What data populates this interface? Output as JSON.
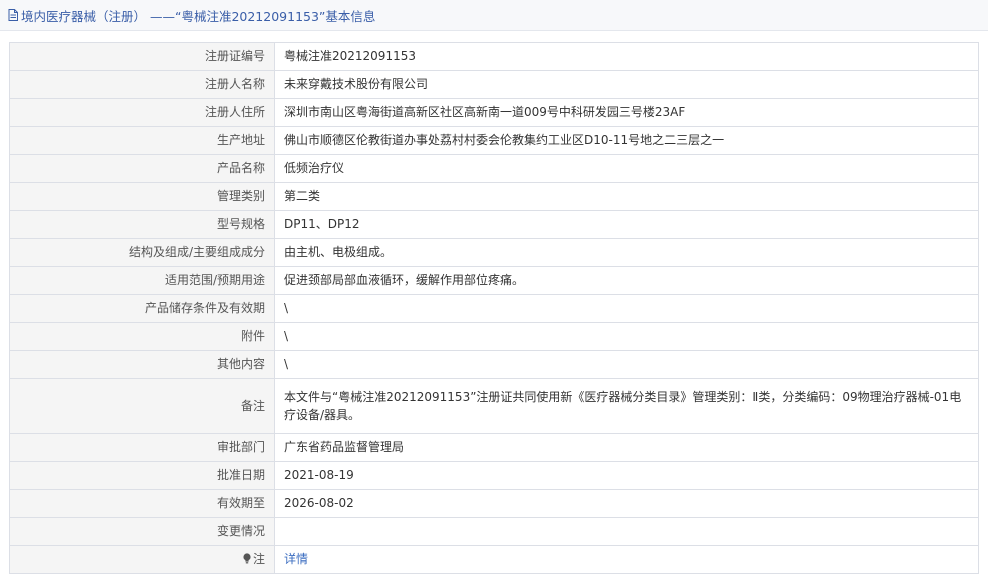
{
  "header": {
    "icon": "document-icon",
    "title": "境内医疗器械（注册） ——“粤械注准20212091153”基本信息"
  },
  "rows": [
    {
      "label": "注册证编号",
      "value": "粤械注准20212091153"
    },
    {
      "label": "注册人名称",
      "value": "未来穿戴技术股份有限公司"
    },
    {
      "label": "注册人住所",
      "value": "深圳市南山区粤海街道高新区社区高新南一道009号中科研发园三号楼23AF"
    },
    {
      "label": "生产地址",
      "value": "佛山市顺德区伦教街道办事处荔村村委会伦教集约工业区D10-11号地之二三层之一"
    },
    {
      "label": "产品名称",
      "value": "低频治疗仪"
    },
    {
      "label": "管理类别",
      "value": "第二类"
    },
    {
      "label": "型号规格",
      "value": "DP11、DP12"
    },
    {
      "label": "结构及组成/主要组成成分",
      "value": "由主机、电极组成。"
    },
    {
      "label": "适用范围/预期用途",
      "value": "促进颈部局部血液循环，缓解作用部位疼痛。"
    },
    {
      "label": "产品储存条件及有效期",
      "value": "\\"
    },
    {
      "label": "附件",
      "value": "\\"
    },
    {
      "label": "其他内容",
      "value": "\\"
    },
    {
      "label": "备注",
      "value": "本文件与“粤械注准20212091153”注册证共同使用新《医疗器械分类目录》管理类别：Ⅱ类，分类编码：09物理治疗器械-01电疗设备/器具。"
    },
    {
      "label": "审批部门",
      "value": "广东省药品监督管理局"
    },
    {
      "label": "批准日期",
      "value": "2021-08-19"
    },
    {
      "label": "有效期至",
      "value": "2026-08-02"
    },
    {
      "label": "变更情况",
      "value": ""
    }
  ],
  "note": {
    "icon": "lightbulb-icon",
    "label": "注",
    "link_text": "详情"
  },
  "colors": {
    "title_text": "#3a5ea8",
    "link": "#3a6cc0",
    "label_bg": "#f5f5f5",
    "border": "#dcdfe6"
  }
}
